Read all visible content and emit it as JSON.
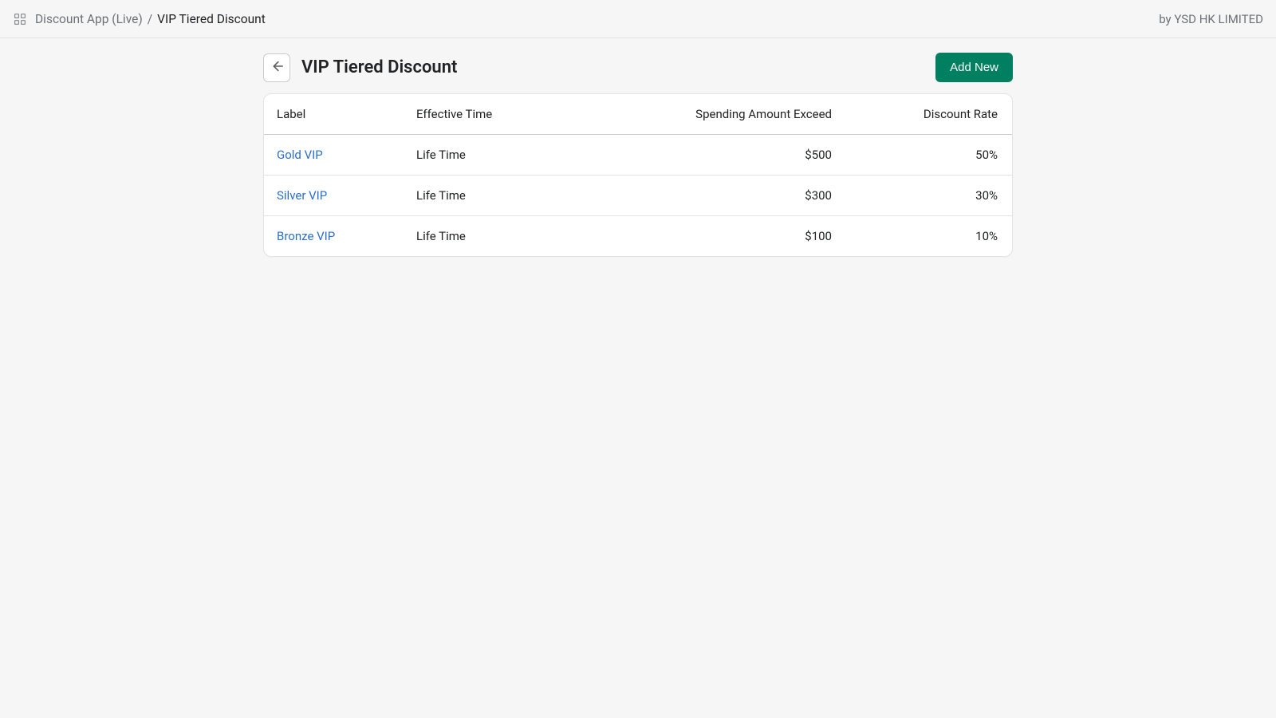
{
  "topbar": {
    "breadcrumb_root": "Discount App (Live)",
    "breadcrumb_sep": "/",
    "breadcrumb_current": "VIP Tiered Discount",
    "vendor_prefix": "by ",
    "vendor_name": "YSD HK LIMITED"
  },
  "header": {
    "title": "VIP Tiered Discount",
    "add_button": "Add New"
  },
  "table": {
    "columns": {
      "label": "Label",
      "effective_time": "Effective Time",
      "spending": "Spending Amount Exceed",
      "discount_rate": "Discount Rate"
    },
    "rows": [
      {
        "label": "Gold VIP",
        "effective_time": "Life Time",
        "spending": "$500",
        "discount_rate": "50%"
      },
      {
        "label": "Silver VIP",
        "effective_time": "Life Time",
        "spending": "$300",
        "discount_rate": "30%"
      },
      {
        "label": "Bronze VIP",
        "effective_time": "Life Time",
        "spending": "$100",
        "discount_rate": "10%"
      }
    ]
  }
}
